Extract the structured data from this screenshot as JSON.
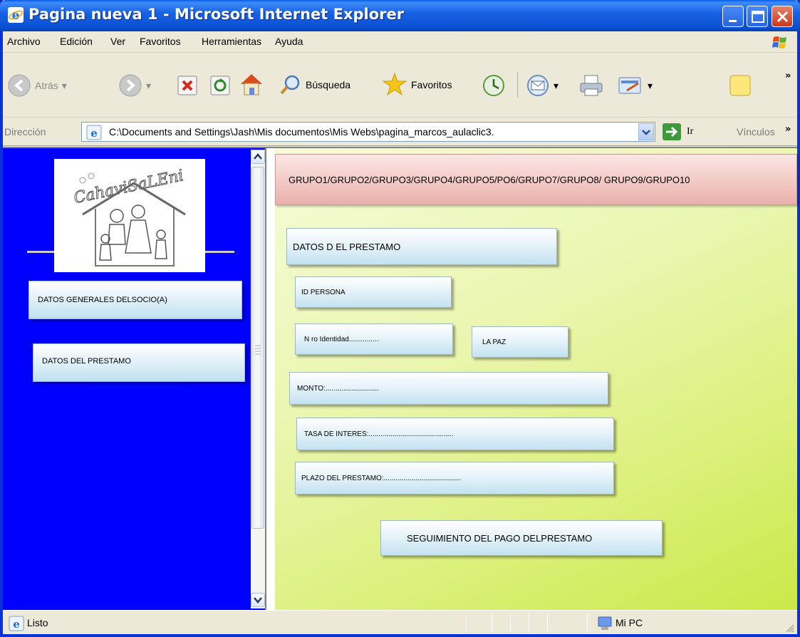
{
  "window": {
    "title": "Pagina nueva 1 - Microsoft Internet Explorer"
  },
  "menubar": {
    "items": [
      "Archivo",
      "Edición",
      "Ver",
      "Favoritos",
      "Herramientas",
      "Ayuda"
    ]
  },
  "toolbar": {
    "back_label": "Atrás",
    "search_label": "Búsqueda",
    "favorites_label": "Favoritos"
  },
  "address": {
    "label": "Dirección",
    "url": "C:\\Documents and Settings\\Jash\\Mis documentos\\Mis Webs\\pagina_marcos_aulaclic3.",
    "go_label": "Ir",
    "links_label": "Vínculos"
  },
  "left_frame": {
    "logo_text": "CahaviSaLEni",
    "buttons": [
      "DATOS GENERALES DELSOCIO(A)",
      "DATOS DEL PRESTAMO"
    ]
  },
  "right_frame": {
    "header": "GRUPO1/GRUPO2/GRUPO3/GRUPO4/GRUPO5/PO6/GRUPO7/GRUPO8/ GRUPO9/GRUPO10",
    "section_title": "DATOS D EL PRESTAMO",
    "fields": {
      "id_persona": "ID PERSONA",
      "nro_identidad": "N ro Identidad...............",
      "lugar": "LA PAZ",
      "monto": "MONTO:...........................",
      "tasa": "TASA DE INTERES:...........................................",
      "plazo": "PLAZO DEL PRESTAMO:.......................................",
      "seguimiento": "SEGUIMIENTO DEL PAGO DELPRESTAMO"
    }
  },
  "statusbar": {
    "status": "Listo",
    "zone": "Mi PC"
  },
  "colors": {
    "left_frame_bg": "#0000ff",
    "right_frame_bg": "#ddf07e",
    "header_bg": "#f2c6c2",
    "button_bg": "#e4f1f9"
  }
}
